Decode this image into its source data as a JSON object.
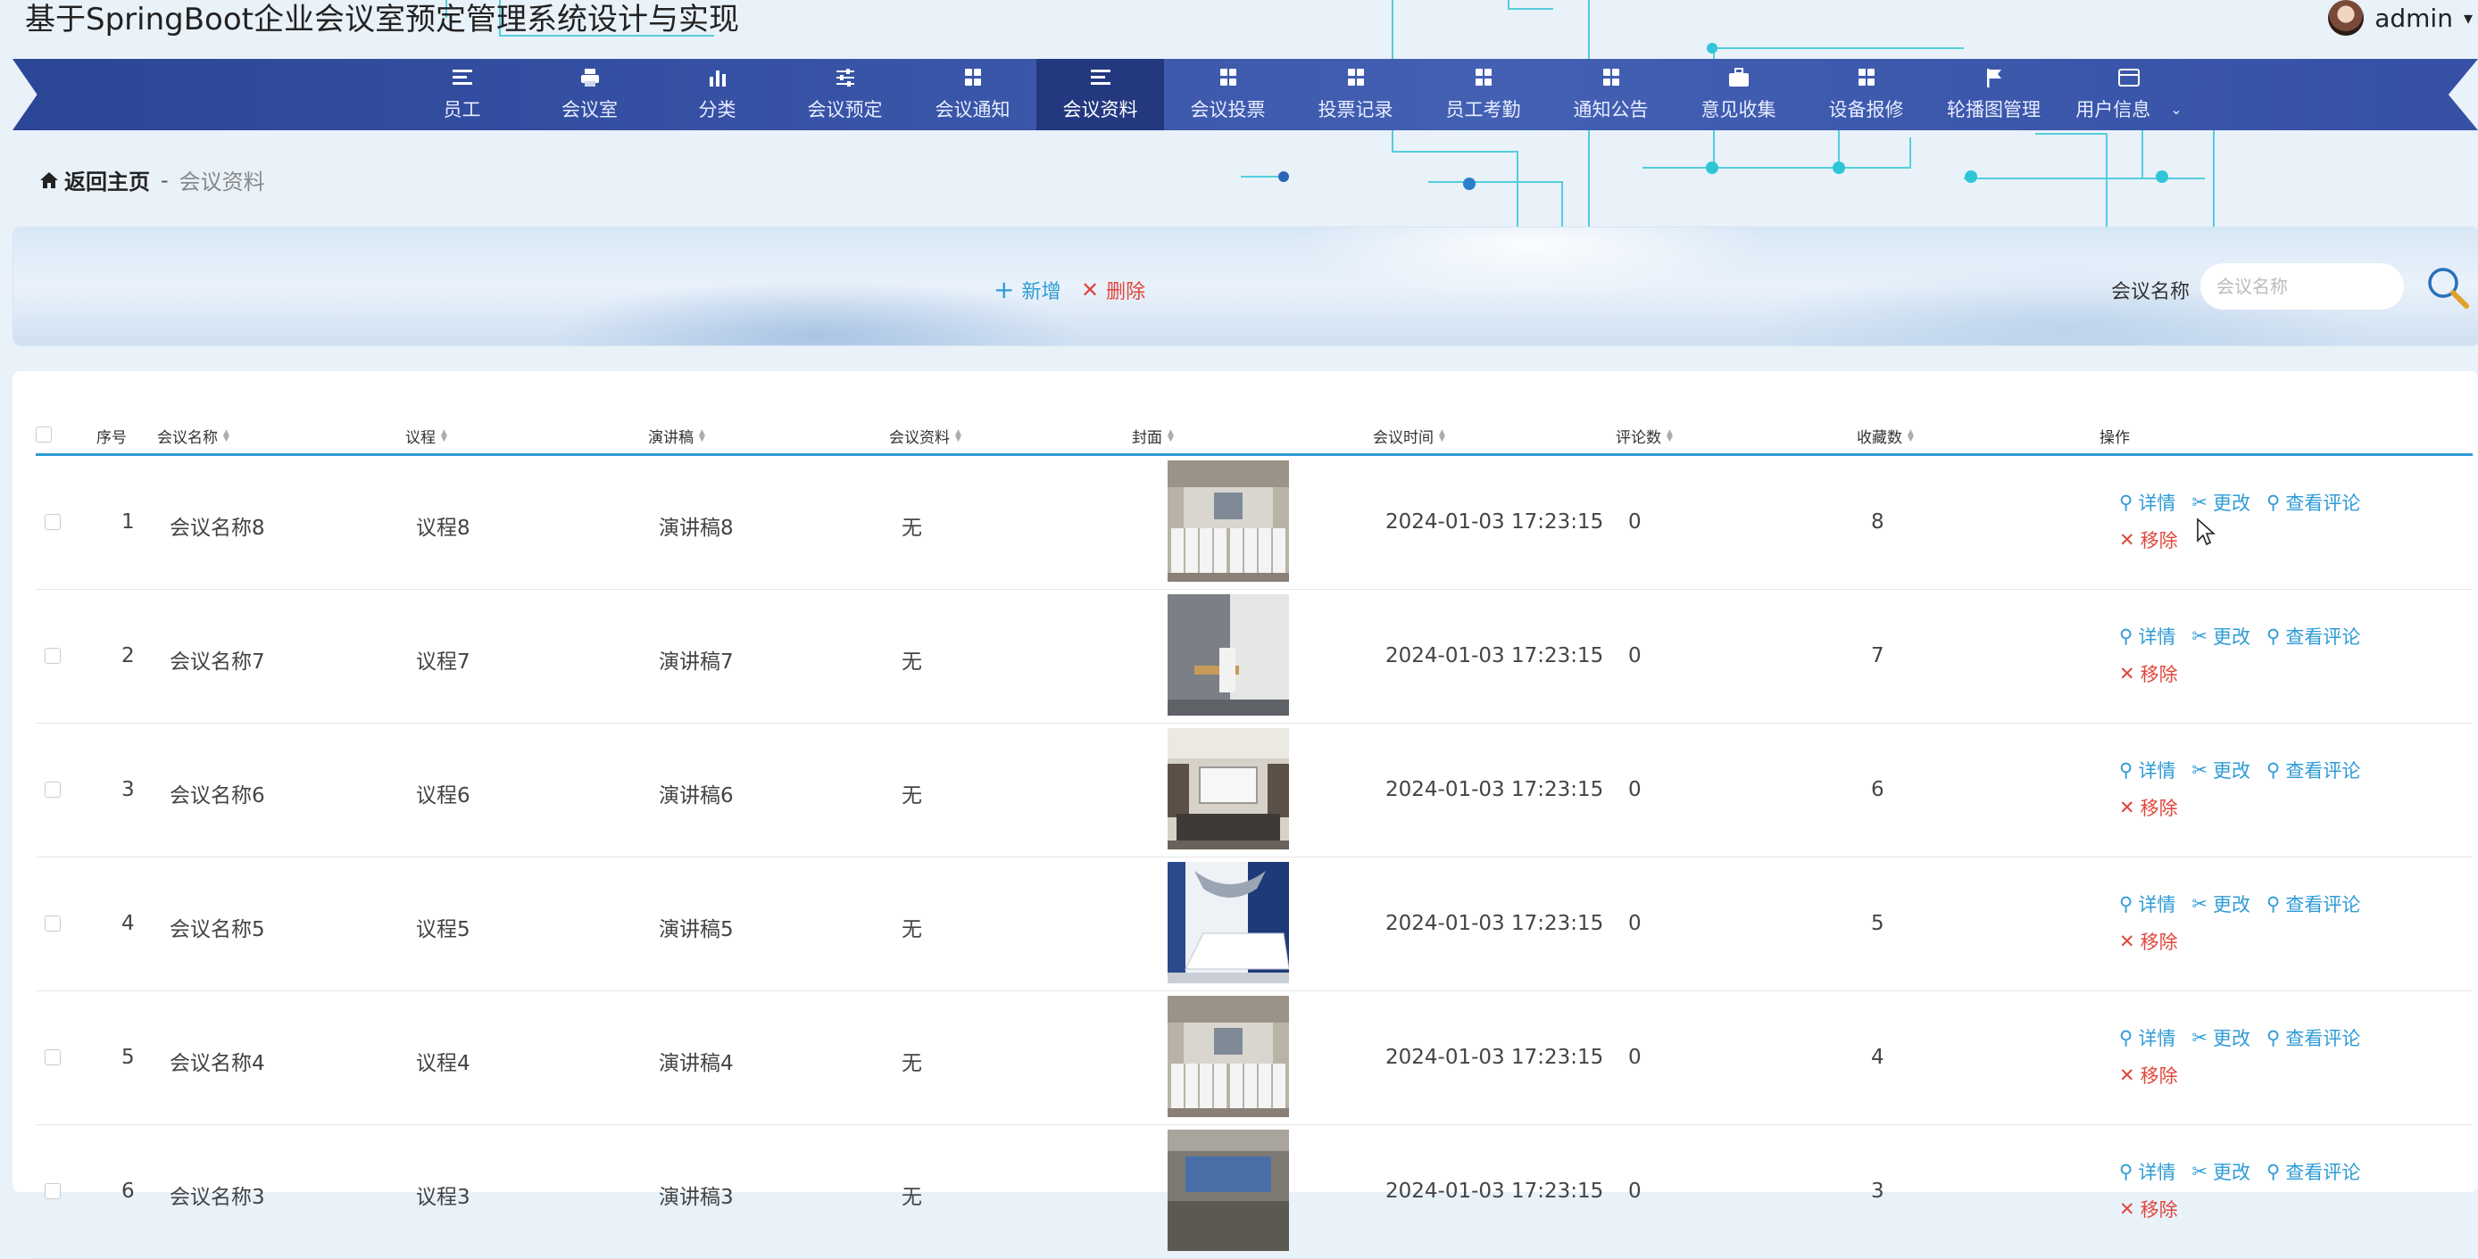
{
  "app": {
    "title": "基于SpringBoot企业会议室预定管理系统设计与实现",
    "user_name": "admin"
  },
  "nav": {
    "items": [
      {
        "label": "员工",
        "icon": "list-icon"
      },
      {
        "label": "会议室",
        "icon": "printer-icon"
      },
      {
        "label": "分类",
        "icon": "bar-chart-icon"
      },
      {
        "label": "会议预定",
        "icon": "sliders-icon"
      },
      {
        "label": "会议通知",
        "icon": "grid-icon"
      },
      {
        "label": "会议资料",
        "icon": "list-icon",
        "active": true
      },
      {
        "label": "会议投票",
        "icon": "grid-icon"
      },
      {
        "label": "投票记录",
        "icon": "grid-icon"
      },
      {
        "label": "员工考勤",
        "icon": "grid-icon"
      },
      {
        "label": "通知公告",
        "icon": "grid-icon"
      },
      {
        "label": "意见收集",
        "icon": "briefcase-icon"
      },
      {
        "label": "设备报修",
        "icon": "grid-icon"
      },
      {
        "label": "轮播图管理",
        "icon": "flag-icon"
      },
      {
        "label": "用户信息",
        "icon": "card-icon"
      }
    ]
  },
  "breadcrumb": {
    "home": "返回主页",
    "separator": "-",
    "current": "会议资料"
  },
  "toolbar": {
    "add": "新增",
    "delete": "删除",
    "search_label": "会议名称",
    "search_placeholder": "会议名称"
  },
  "table": {
    "headers": {
      "index": "序号",
      "name": "会议名称",
      "agenda": "议程",
      "speech": "演讲稿",
      "material": "会议资料",
      "cover": "封面",
      "time": "会议时间",
      "comments": "评论数",
      "favorites": "收藏数",
      "actions": "操作"
    },
    "actions": {
      "detail": "详情",
      "edit": "更改",
      "comments": "查看评论",
      "remove": "移除"
    },
    "rows": [
      {
        "index": "1",
        "name": "会议名称8",
        "agenda": "议程8",
        "speech": "演讲稿8",
        "material": "无",
        "cover": "conference-hall",
        "time": "2024-01-03 17:23:15",
        "comments": "0",
        "favorites": "8"
      },
      {
        "index": "2",
        "name": "会议名称7",
        "agenda": "议程7",
        "speech": "演讲稿7",
        "material": "无",
        "cover": "small-office",
        "time": "2024-01-03 17:23:15",
        "comments": "0",
        "favorites": "7"
      },
      {
        "index": "3",
        "name": "会议名称6",
        "agenda": "议程6",
        "speech": "演讲稿6",
        "material": "无",
        "cover": "meeting-room",
        "time": "2024-01-03 17:23:15",
        "comments": "0",
        "favorites": "6"
      },
      {
        "index": "4",
        "name": "会议名称5",
        "agenda": "议程5",
        "speech": "演讲稿5",
        "material": "无",
        "cover": "boardroom",
        "time": "2024-01-03 17:23:15",
        "comments": "0",
        "favorites": "5"
      },
      {
        "index": "5",
        "name": "会议名称4",
        "agenda": "议程4",
        "speech": "演讲稿4",
        "material": "无",
        "cover": "conference-hall",
        "time": "2024-01-03 17:23:15",
        "comments": "0",
        "favorites": "4"
      },
      {
        "index": "6",
        "name": "会议名称3",
        "agenda": "议程3",
        "speech": "演讲稿3",
        "material": "无",
        "cover": "screen-room",
        "time": "2024-01-03 17:23:15",
        "comments": "0",
        "favorites": "3"
      }
    ]
  },
  "colors": {
    "nav_bg": "#3a56a8",
    "nav_active": "#23387f",
    "accent": "#2e9bd6",
    "danger": "#e0463c"
  }
}
